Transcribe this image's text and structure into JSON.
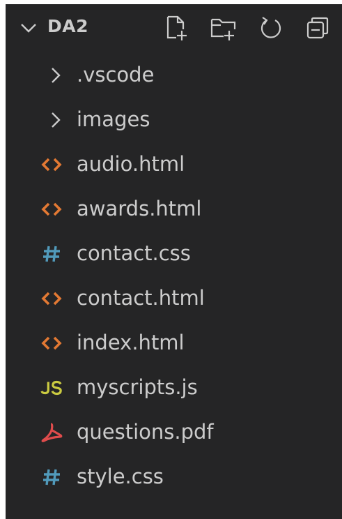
{
  "explorer": {
    "title": "DA2",
    "actions": [
      {
        "name": "new-file-button",
        "icon": "new-file-icon"
      },
      {
        "name": "new-folder-button",
        "icon": "new-folder-icon"
      },
      {
        "name": "refresh-button",
        "icon": "refresh-icon"
      },
      {
        "name": "collapse-all-button",
        "icon": "collapse-all-icon"
      }
    ],
    "items": [
      {
        "label": ".vscode",
        "kind": "folder",
        "icon": "chevron-right-icon"
      },
      {
        "label": "images",
        "kind": "folder",
        "icon": "chevron-right-icon"
      },
      {
        "label": "audio.html",
        "kind": "file",
        "icon": "html-file-icon",
        "color": "#e37933"
      },
      {
        "label": "awards.html",
        "kind": "file",
        "icon": "html-file-icon",
        "color": "#e37933"
      },
      {
        "label": "contact.css",
        "kind": "file",
        "icon": "css-file-icon",
        "color": "#519aba"
      },
      {
        "label": "contact.html",
        "kind": "file",
        "icon": "html-file-icon",
        "color": "#e37933"
      },
      {
        "label": "index.html",
        "kind": "file",
        "icon": "html-file-icon",
        "color": "#e37933"
      },
      {
        "label": "myscripts.js",
        "kind": "file",
        "icon": "js-file-icon",
        "color": "#cbcb41"
      },
      {
        "label": "questions.pdf",
        "kind": "file",
        "icon": "pdf-file-icon",
        "color": "#e04c4c"
      },
      {
        "label": "style.css",
        "kind": "file",
        "icon": "css-file-icon",
        "color": "#519aba"
      }
    ]
  },
  "colors": {
    "background": "#252526",
    "text": "#cccccc",
    "html": "#e37933",
    "css": "#519aba",
    "js": "#cbcb41",
    "pdf": "#e04c4c"
  }
}
